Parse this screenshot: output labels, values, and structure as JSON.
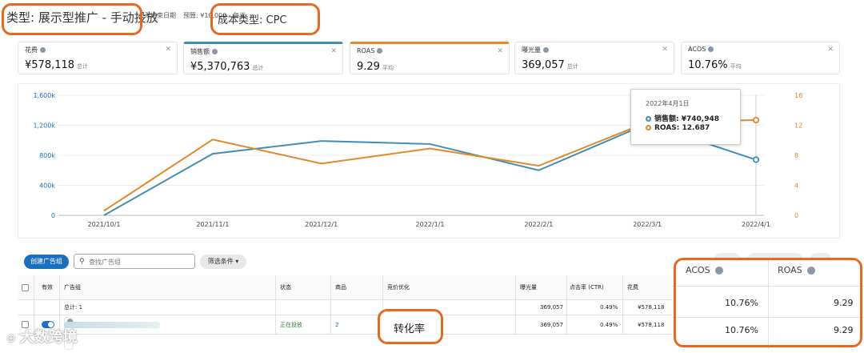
{
  "header": {
    "type_label": "类型: 展示型推广 - 手动投放",
    "end_date": "无结束日期",
    "budget": "预算: ¥10,000 - 每天",
    "cost_type": "成本类型: CPC"
  },
  "metrics": [
    {
      "label": "花费",
      "value": "¥578,118",
      "suffix": "总计"
    },
    {
      "label": "销售额",
      "value": "¥5,370,763",
      "suffix": "总计"
    },
    {
      "label": "ROAS",
      "value": "9.29",
      "suffix": "平均"
    },
    {
      "label": "曝光量",
      "value": "369,057",
      "suffix": "总计"
    },
    {
      "label": "ACOS",
      "value": "10.76%",
      "suffix": "平均"
    }
  ],
  "colors": {
    "sales": "#3f8fb5",
    "roas": "#e38826",
    "accent": "#1a6fbf",
    "annotation": "#e8681f"
  },
  "chart_data": {
    "type": "line",
    "x": [
      "2021/10/1",
      "2021/11/1",
      "2021/12/1",
      "2022/1/1",
      "2022/2/1",
      "2022/3/1",
      "2022/4/1"
    ],
    "y_left_ticks": [
      "0",
      "400k",
      "800k",
      "1,200k",
      "1,600k"
    ],
    "y_right_ticks": [
      "0",
      "4",
      "8",
      "12",
      "16"
    ],
    "ylim_left": [
      0,
      1600000
    ],
    "ylim_right": [
      0,
      16
    ],
    "series": [
      {
        "name": "销售额",
        "axis": "left",
        "x": [
          0,
          1,
          2,
          3,
          4,
          5,
          6
        ],
        "values": [
          0,
          820000,
          990000,
          950000,
          600000,
          1220000,
          740948
        ]
      },
      {
        "name": "ROAS",
        "axis": "right",
        "x": [
          0,
          1,
          2,
          3,
          4,
          5,
          6
        ],
        "values": [
          0.6,
          10.1,
          6.9,
          8.9,
          6.6,
          12.4,
          12.687
        ]
      }
    ],
    "grid": true
  },
  "tooltip": {
    "date": "2022年4月1日",
    "sales_line": "销售额: ¥740,948",
    "roas_line": "ROAS: 12.687"
  },
  "toolbar": {
    "create_label": "创建广告组",
    "search_placeholder": "查找广告组",
    "filter_label": "筛选条件"
  },
  "table": {
    "headers": {
      "active": "有效",
      "group": "广告组",
      "status": "状态",
      "products": "商品",
      "bid": "竞价优化",
      "impressions": "曝光量",
      "ctr": "点击率 (CTR)",
      "spend": "花费"
    },
    "total_row": {
      "label": "总计: 1",
      "impressions": "369,057",
      "ctr": "0.49%",
      "spend": "¥578,118"
    },
    "data_row": {
      "status": "正在投放",
      "products": "2",
      "impressions": "369,057",
      "ctr": "0.49%",
      "spend": "¥578,118"
    }
  },
  "highlight": {
    "acos_header": "ACOS",
    "roas_header": "ROAS",
    "acos_total": "10.76%",
    "roas_total": "9.29",
    "acos_row": "10.76%",
    "roas_row": "9.29",
    "conversion_label": "转化率"
  },
  "watermark": "大数跨境"
}
